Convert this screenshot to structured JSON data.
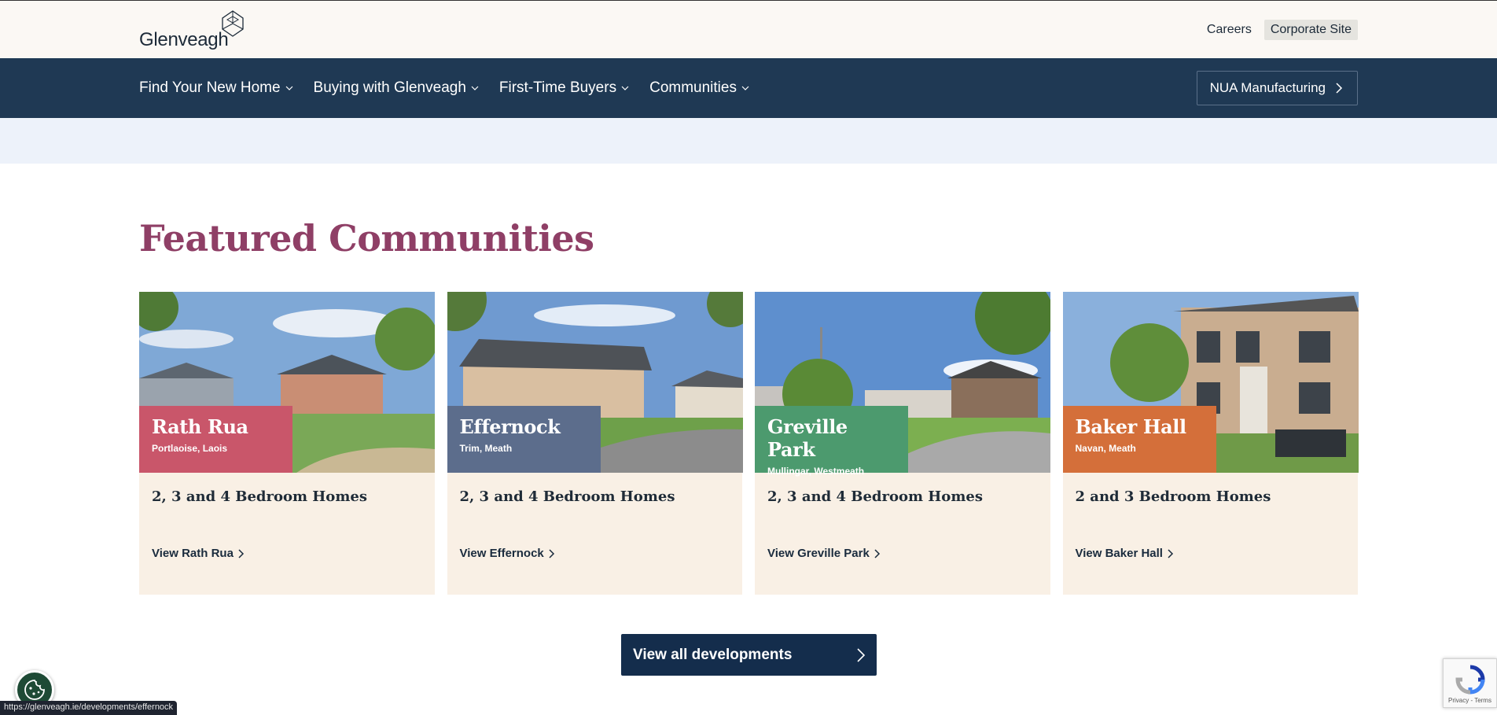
{
  "header": {
    "logo_text": "Glenveagh",
    "top_links": [
      {
        "label": "Careers"
      },
      {
        "label": "Corporate Site"
      }
    ]
  },
  "nav": {
    "items": [
      {
        "label": "Find Your New Home"
      },
      {
        "label": "Buying with Glenveagh"
      },
      {
        "label": "First-Time Buyers"
      },
      {
        "label": "Communities"
      }
    ],
    "nua_button": "NUA Manufacturing"
  },
  "featured": {
    "title": "Featured Communities",
    "cards": [
      {
        "name": "Rath Rua",
        "location": "Portlaoise, Laois",
        "bedrooms": "2, 3 and 4 Bedroom Homes",
        "link": "View Rath Rua",
        "label_color": "#c9566a"
      },
      {
        "name": "Effernock",
        "location": "Trim, Meath",
        "bedrooms": "2, 3 and 4 Bedroom Homes",
        "link": "View Effernock",
        "label_color": "#5c6d8c"
      },
      {
        "name": "Greville Park",
        "location": "Mullingar, Westmeath",
        "bedrooms": "2, 3 and 4 Bedroom Homes",
        "link": "View Greville Park",
        "label_color": "#4c9a6e"
      },
      {
        "name": "Baker Hall",
        "location": "Navan, Meath",
        "bedrooms": "2 and 3 Bedroom Homes",
        "link": "View Baker Hall",
        "label_color": "#d46f3a"
      }
    ],
    "cta_label": "View all developments"
  },
  "status_url": "https://glenveagh.ie/developments/effernock",
  "recaptcha_text": "Privacy - Terms",
  "icons": [
    "chevron-down-icon",
    "chevron-right-icon",
    "cookie-icon",
    "recaptcha-icon",
    "logo-mark-icon"
  ]
}
